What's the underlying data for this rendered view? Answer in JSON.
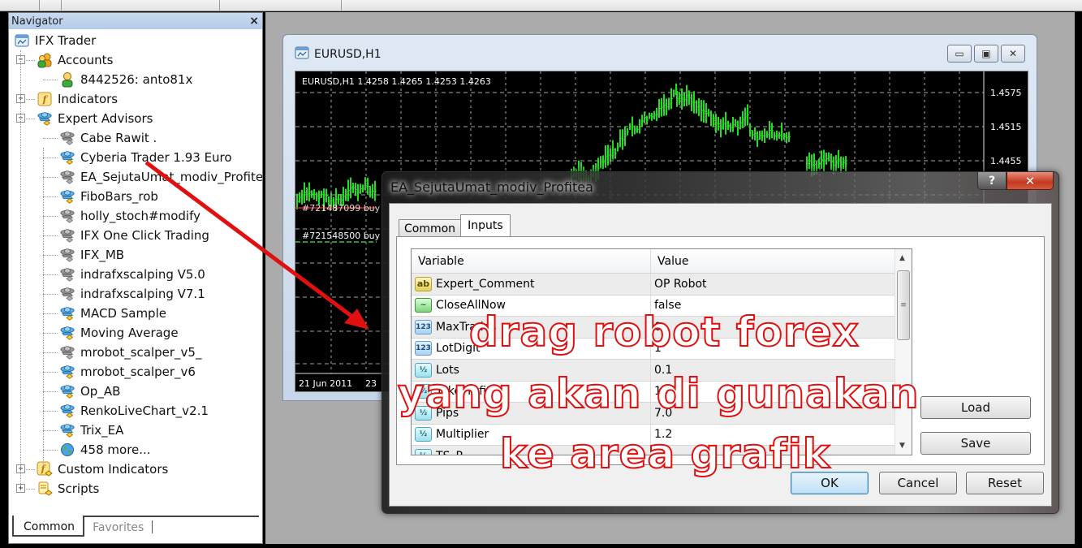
{
  "navigator": {
    "title": "Navigator",
    "close_label": "×",
    "root": "IFX Trader",
    "accounts": {
      "label": "Accounts",
      "items": [
        "8442526: anto81x"
      ]
    },
    "indicators_label": "Indicators",
    "expert_advisors": {
      "label": "Expert Advisors",
      "items": [
        {
          "label": "Cabe Rawit .",
          "active": false
        },
        {
          "label": "Cyberia Trader 1.93 Euro",
          "active": true
        },
        {
          "label": "EA_SejutaUmat_modiv_Profitea",
          "active": false
        },
        {
          "label": "FiboBars_rob",
          "active": true
        },
        {
          "label": "holly_stoch#modify",
          "active": false
        },
        {
          "label": "IFX One Click Trading",
          "active": false
        },
        {
          "label": "IFX_MB",
          "active": false
        },
        {
          "label": "indrafxscalping V5.0",
          "active": false
        },
        {
          "label": "indrafxscalping V7.1",
          "active": false
        },
        {
          "label": "MACD Sample",
          "active": true
        },
        {
          "label": "Moving Average",
          "active": true
        },
        {
          "label": "mrobot_scalper_v5_",
          "active": false
        },
        {
          "label": "mrobot_scalper_v6",
          "active": true
        },
        {
          "label": "Op_AB",
          "active": true
        },
        {
          "label": "RenkoLiveChart_v2.1",
          "active": true
        },
        {
          "label": "Trix_EA",
          "active": true
        }
      ],
      "more_label": "458 more..."
    },
    "custom_indicators_label": "Custom Indicators",
    "scripts_label": "Scripts",
    "tabs": [
      "Common",
      "Favorites"
    ],
    "active_tab": "Common"
  },
  "chart_window": {
    "title": "EURUSD,H1",
    "info": "EURUSD,H1  1.4258 1.4265 1.4253 1.4263",
    "price_labels": [
      "1.4575",
      "1.4515",
      "1.4455"
    ],
    "date_labels": [
      "21 Jun 2011",
      "23"
    ],
    "orders": [
      "#721487099 buy",
      "#721548500 buy"
    ],
    "colors": {
      "bars": "#22dd22",
      "background": "#000000",
      "grid": "#cfcfcf",
      "order_line": "#e02020"
    },
    "buttons": {
      "minimize": "minimize",
      "restore": "restore",
      "close": "close"
    }
  },
  "dialog": {
    "title": "EA_SejutaUmat_modiv_Profitea",
    "help_label": "?",
    "close_label": "✕",
    "tabs": [
      "Common",
      "Inputs"
    ],
    "active_tab": "Inputs",
    "columns": [
      "Variable",
      "Value"
    ],
    "rows": [
      {
        "type": "string",
        "icon": "ab",
        "variable": "Expert_Comment",
        "value": "OP Robot"
      },
      {
        "type": "bool",
        "icon": "~",
        "variable": "CloseAllNow",
        "value": "false"
      },
      {
        "type": "int",
        "icon": "123",
        "variable": "MaxTrades",
        "value": "0"
      },
      {
        "type": "int",
        "icon": "123",
        "variable": "LotDigit",
        "value": "1"
      },
      {
        "type": "double",
        "icon": "½",
        "variable": "Lots",
        "value": "0.1"
      },
      {
        "type": "double",
        "icon": "½",
        "variable": "TakeProfit",
        "value": "10"
      },
      {
        "type": "double",
        "icon": "½",
        "variable": "Pips",
        "value": "7.0"
      },
      {
        "type": "double",
        "icon": "½",
        "variable": "Multiplier",
        "value": "1.2"
      },
      {
        "type": "double",
        "icon": "½",
        "variable": "TS_P",
        "value": ""
      }
    ],
    "load_label": "Load",
    "save_label": "Save",
    "ok_label": "OK",
    "cancel_label": "Cancel",
    "reset_label": "Reset"
  },
  "annotation": {
    "lines": [
      "drag robot forex",
      "yang akan di gunakan",
      "ke area grafik"
    ],
    "color": "#e01010"
  }
}
